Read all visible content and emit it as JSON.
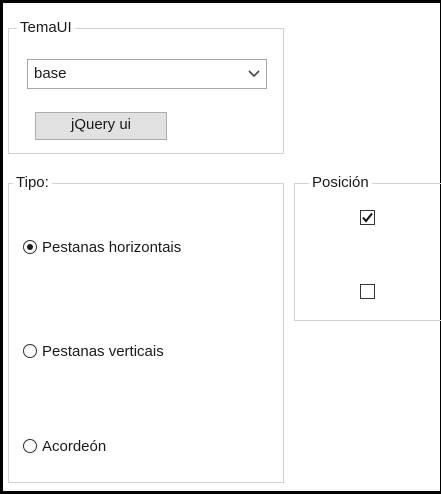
{
  "theme_group": {
    "legend": "TemaUI",
    "select_value": "base",
    "button_label": "jQuery ui"
  },
  "tipo_group": {
    "legend": "Tipo:",
    "options": [
      {
        "label": "Pestanas horizontais",
        "checked": true
      },
      {
        "label": "Pestanas verticais",
        "checked": false
      },
      {
        "label": "Acordeón",
        "checked": false
      }
    ]
  },
  "posicion_group": {
    "legend": "Posición",
    "checkboxes": [
      {
        "checked": true
      },
      {
        "checked": false
      }
    ]
  },
  "icons": {
    "dropdown": "chevron-down-icon",
    "check": "checkmark-icon"
  }
}
